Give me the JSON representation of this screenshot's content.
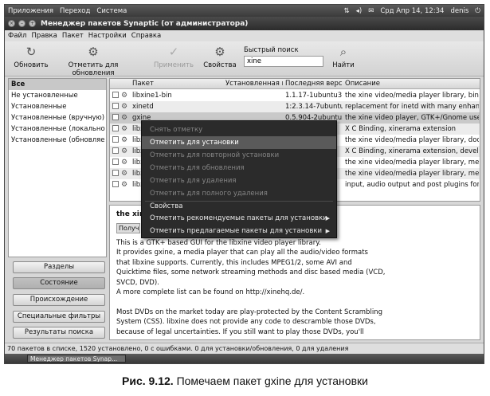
{
  "top_panel": {
    "menus": [
      "Приложения",
      "Переход",
      "Система"
    ],
    "date_time": "Срд Апр 14, 12:34",
    "user": "denis"
  },
  "window": {
    "title": "Менеджер пакетов Synaptic  (от администратора)"
  },
  "menubar": [
    "Файл",
    "Правка",
    "Пакет",
    "Настройки",
    "Справка"
  ],
  "toolbar": {
    "reload_label": "Обновить",
    "mark_upgrades_label": "Отметить для обновления",
    "apply_label": "Применить",
    "properties_label": "Свойства",
    "quick_search_label": "Быстрый поиск",
    "quick_search_value": "xine",
    "search_label": "Найти"
  },
  "filters": [
    "Все",
    "Не установленные",
    "Установленные",
    "Установленные (вручную)",
    "Установленные (локально и",
    "Установленные (обновляе"
  ],
  "side_buttons": {
    "sections": "Разделы",
    "status": "Состояние",
    "origin": "Происхождение",
    "custom_filters": "Специальные фильтры",
    "search_results": "Результаты поиска"
  },
  "table": {
    "col_package": "Пакет",
    "col_installed": "Установленная в",
    "col_latest": "Последняя верси",
    "col_description": "Описание",
    "rows": [
      {
        "name": "libxine1-bin",
        "installed": "",
        "latest": "1.1.17-1ubuntu3",
        "desc": "the xine video/media player library, binary"
      },
      {
        "name": "xinetd",
        "installed": "",
        "latest": "1:2.3.14-7ubuntu3",
        "desc": "replacement for inetd with many enhancem"
      },
      {
        "name": "gxine",
        "installed": "",
        "latest": "0.5.904-2ubuntu3",
        "desc": "the xine video player, GTK+/Gnome user in"
      },
      {
        "name": "libx",
        "installed": "",
        "latest": "",
        "desc": "X C Binding, xinerama extension"
      },
      {
        "name": "libx",
        "installed": "",
        "latest": "",
        "desc": "the xine video/media player library, docume"
      },
      {
        "name": "libx",
        "installed": "",
        "latest": "",
        "desc": "X C Binding, xinerama extension, developm"
      },
      {
        "name": "libx",
        "installed": "",
        "latest": "",
        "desc": "the xine video/media player library, meta p"
      },
      {
        "name": "libx",
        "installed": "",
        "latest": "",
        "desc": "the xine video/media player library, meta p"
      },
      {
        "name": "libx",
        "installed": "",
        "latest": "",
        "desc": "input, audio output and post plugins for lib"
      }
    ]
  },
  "context_menu": {
    "unmark": "Снять отметку",
    "mark_install": "Отметить для установки",
    "mark_reinstall": "Отметить для повторной установки",
    "mark_upgrade": "Отметить для обновления",
    "mark_removal": "Отметить для удаления",
    "mark_complete_removal": "Отметить для полного удаления",
    "properties": "Свойства",
    "mark_recommended": "Отметить рекомендуемые пакеты для установки",
    "mark_suggested": "Отметить предлагаемые пакеты для установки"
  },
  "description": {
    "title": "the xine",
    "screenshot_button": "Получ",
    "lines": [
      "This is a GTK+ based GUI for the libxine video player library.",
      "It provides gxine, a  media player that can play all the audio/video formats",
      "that libxine supports. Currently, this includes MPEG1/2, some AVI and",
      "Quicktime files, some network streaming methods and disc based media (VCD,",
      "SVCD, DVD).",
      "A more complete list can be found on http://xinehq.de/.",
      "",
      "Most DVDs on the market today are play-protected by the Content Scrambling",
      "System (CSS). libxine does not provide any code to descramble those DVDs,",
      "because of legal uncertainties. If you still want to play those DVDs, you'll"
    ]
  },
  "statusbar": "70 пакетов в списке, 1520 установлено, 0 с ошибками. 0 для установки/обновления, 0 для удаления",
  "taskbar": {
    "item": "Менеджер пакетов Synap..."
  },
  "caption": {
    "number": "Рис. 9.12.",
    "text": "Помечаем пакет gxine для установки"
  }
}
